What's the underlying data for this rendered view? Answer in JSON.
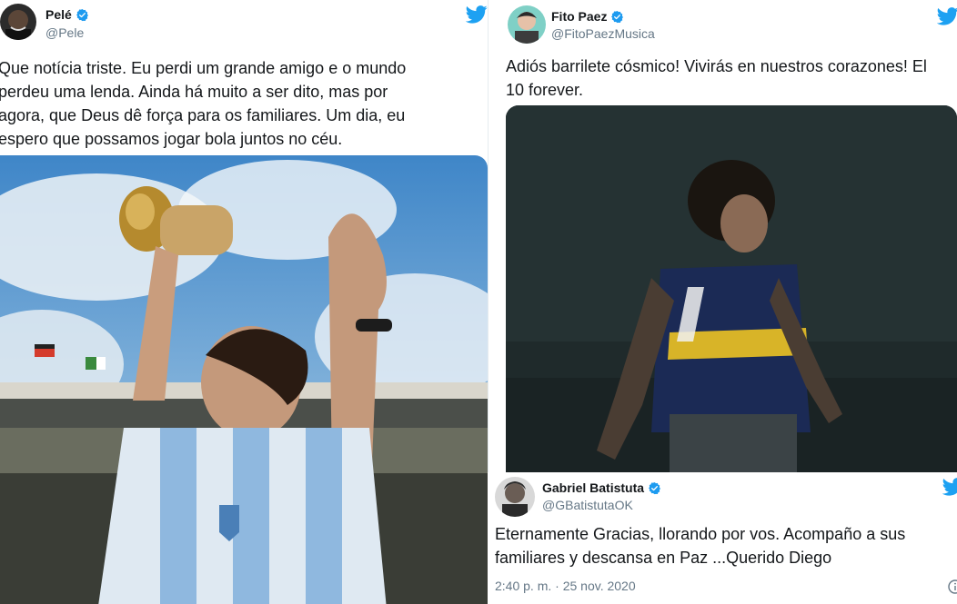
{
  "tweets": {
    "pele": {
      "name": "Pelé",
      "handle": "@Pele",
      "lines": [
        "Que notícia triste. Eu perdi um grande amigo e o mundo",
        "perdeu uma lenda. Ainda há muito a ser dito, mas por",
        "agora, que Deus dê força para os familiares. Um dia, eu",
        "espero que possamos jogar bola juntos no céu."
      ]
    },
    "fito": {
      "name": "Fito Paez",
      "handle": "@FitoPaezMusica",
      "lines": [
        "Adiós barrilete cósmico! Vivirás en nuestros corazones! El",
        "10 forever."
      ]
    },
    "batistuta": {
      "name": "Gabriel Batistuta",
      "handle": "@GBatistutaOK",
      "lines": [
        "Eternamente Gracias, llorando por vos. Acompaño a sus",
        "familiares y descansa en Paz ...Querido Diego"
      ],
      "timestamp": "2:40 p. m. · 25 nov. 2020"
    }
  },
  "colors": {
    "twitter_blue": "#1da1f2",
    "verified_blue": "#1d9bf0",
    "secondary_text": "#657786"
  },
  "icons": {
    "verified": "verified-badge-icon",
    "bird": "twitter-bird-icon",
    "info": "info-icon"
  }
}
